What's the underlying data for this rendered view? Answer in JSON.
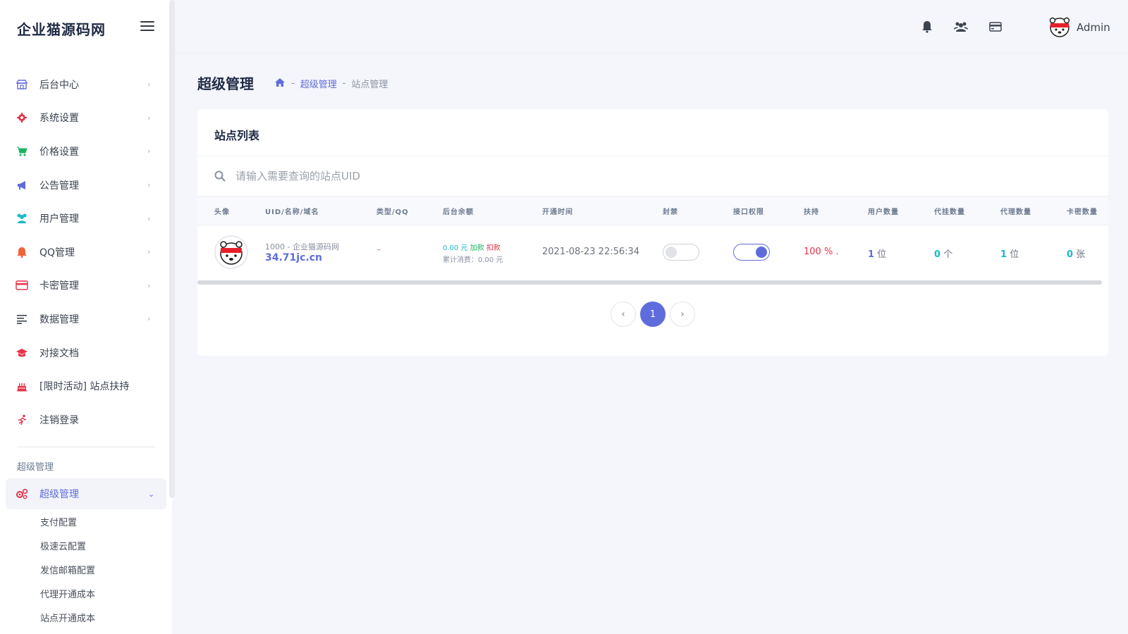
{
  "brand": "企业猫源码网",
  "sidebar": {
    "items": [
      {
        "label": "后台中心",
        "icon": "store-icon",
        "color": "#5f6cdc"
      },
      {
        "label": "系统设置",
        "icon": "gear-icon",
        "color": "#e6344a"
      },
      {
        "label": "价格设置",
        "icon": "cart-icon",
        "color": "#1bb360"
      },
      {
        "label": "公告管理",
        "icon": "megaphone-icon",
        "color": "#5f6cdc"
      },
      {
        "label": "用户管理",
        "icon": "users-icon",
        "color": "#1bb9c9"
      },
      {
        "label": "QQ管理",
        "icon": "bell-icon",
        "color": "#f0643c"
      },
      {
        "label": "卡密管理",
        "icon": "card-icon",
        "color": "#e6344a"
      },
      {
        "label": "数据管理",
        "icon": "list-icon",
        "color": "#3b4350"
      },
      {
        "label": "对接文档",
        "icon": "graduation-cap-icon",
        "color": "#e6344a"
      },
      {
        "label": "[限时活动] 站点扶持",
        "icon": "cake-icon",
        "color": "#e6344a"
      },
      {
        "label": "注销登录",
        "icon": "runner-icon",
        "color": "#e6344a"
      }
    ],
    "section_title": "超级管理",
    "active": {
      "label": "超级管理",
      "icon": "cogs-icon"
    },
    "submenu": [
      "支付配置",
      "极速云配置",
      "发信邮箱配置",
      "代理开通成本",
      "站点开通成本"
    ]
  },
  "topbar": {
    "admin_name": "Admin"
  },
  "page": {
    "title": "超级管理",
    "breadcrumb": [
      "超级管理",
      "站点管理"
    ],
    "breadcrumb_sep": "-"
  },
  "card": {
    "title": "站点列表",
    "search_placeholder": "请输入需要查询的站点UID",
    "columns": [
      "头像",
      "UID/名称/域名",
      "类型/QQ",
      "后台余额",
      "开通时间",
      "封禁",
      "接口权限",
      "扶持",
      "用户数量",
      "代挂数量",
      "代理数量",
      "卡密数量"
    ],
    "rows": [
      {
        "uid_name": "1000 - 企业猫源码网",
        "domain": "34.71jc.cn",
        "type_qq": "~",
        "balance": "0.00 元",
        "add_label": "加款",
        "sub_label": "扣款",
        "consumed": "累计消费：0.00 元",
        "open_time": "2021-08-23 22:56:34",
        "banned": false,
        "api_permission": true,
        "support": "100 % .",
        "users_num": "1",
        "users_unit": "位",
        "hang_num": "0",
        "hang_unit": "个",
        "agents_num": "1",
        "agents_unit": "位",
        "cards_num": "0",
        "cards_unit": "张"
      }
    ],
    "pagination": {
      "prev": "‹",
      "current": "1",
      "next": "›"
    }
  }
}
